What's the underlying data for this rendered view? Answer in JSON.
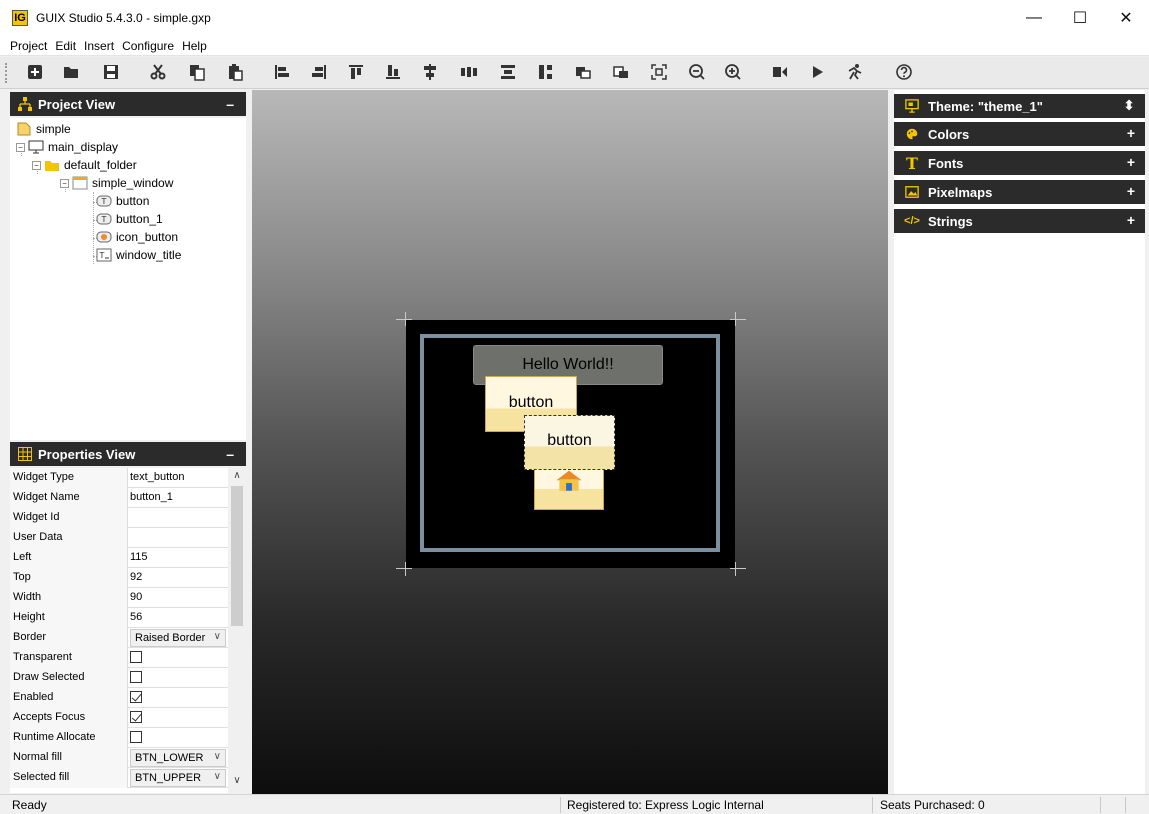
{
  "window": {
    "title": "GUIX Studio 5.4.3.0 - simple.gxp",
    "app_icon": "IG",
    "controls": [
      "—",
      "☐",
      "✕"
    ]
  },
  "menu": [
    "Project",
    "Edit",
    "Insert",
    "Configure",
    "Help"
  ],
  "toolbar": {
    "icons": [
      "add-icon",
      "open-folder-icon",
      "save-icon",
      "cut-icon",
      "copy-icon",
      "paste-icon",
      "align-left-icon",
      "align-right-icon",
      "align-top-icon",
      "align-bottom-icon",
      "center-horizontal-icon",
      "equal-width-icon",
      "equal-height-icon",
      "vertical-space-icon",
      "move-to-front-icon",
      "move-to-back-icon",
      "size-to-fit-icon",
      "zoom-out-icon",
      "zoom-in-icon",
      "record-macro-icon",
      "run-icon",
      "playback-icon",
      "help-icon"
    ]
  },
  "project_view": {
    "title": "Project View",
    "tree": [
      {
        "label": "simple",
        "icon": "project-file-icon"
      },
      {
        "label": "main_display",
        "icon": "display-icon"
      },
      {
        "label": "default_folder",
        "icon": "folder-icon"
      },
      {
        "label": "simple_window",
        "icon": "window-icon"
      },
      {
        "label": "button",
        "icon": "text-button-icon"
      },
      {
        "label": "button_1",
        "icon": "text-button-icon"
      },
      {
        "label": "icon_button",
        "icon": "icon-button-icon"
      },
      {
        "label": "window_title",
        "icon": "prompt-icon"
      }
    ]
  },
  "properties_view": {
    "title": "Properties View",
    "rows": [
      {
        "name": "Widget Type",
        "value": "text_button",
        "kind": "text"
      },
      {
        "name": "Widget Name",
        "value": "button_1",
        "kind": "input"
      },
      {
        "name": "Widget Id",
        "value": "",
        "kind": "input"
      },
      {
        "name": "User Data",
        "value": "",
        "kind": "input"
      },
      {
        "name": "Left",
        "value": "115",
        "kind": "input"
      },
      {
        "name": "Top",
        "value": "92",
        "kind": "input"
      },
      {
        "name": "Width",
        "value": "90",
        "kind": "input"
      },
      {
        "name": "Height",
        "value": "56",
        "kind": "input"
      },
      {
        "name": "Border",
        "value": "Raised Border",
        "kind": "select"
      },
      {
        "name": "Transparent",
        "value": false,
        "kind": "check"
      },
      {
        "name": "Draw Selected",
        "value": false,
        "kind": "check"
      },
      {
        "name": "Enabled",
        "value": true,
        "kind": "check"
      },
      {
        "name": "Accepts Focus",
        "value": true,
        "kind": "check"
      },
      {
        "name": "Runtime Allocate",
        "value": false,
        "kind": "check"
      },
      {
        "name": "Normal fill",
        "value": "BTN_LOWER",
        "kind": "select"
      },
      {
        "name": "Selected fill",
        "value": "BTN_UPPER",
        "kind": "select"
      }
    ]
  },
  "canvas": {
    "window_title_text": "Hello World!!",
    "button_text": "button",
    "button_1_text": "button"
  },
  "resources": {
    "theme_label": "Theme: \"theme_1\"",
    "sections": [
      {
        "label": "Colors",
        "icon": "palette-icon"
      },
      {
        "label": "Fonts",
        "icon": "font-icon"
      },
      {
        "label": "Pixelmaps",
        "icon": "image-icon"
      },
      {
        "label": "Strings",
        "icon": "code-icon"
      }
    ]
  },
  "statusbar": {
    "status": "Ready",
    "registered": "Registered to: Express Logic Internal",
    "seats": "Seats Purchased: 0"
  },
  "colors": {
    "panel_header": "#2b2b2b",
    "window_border": "#7c8fa0",
    "button_fill_top": "#fff7e0",
    "button_fill_bottom": "#f6e3a0"
  }
}
